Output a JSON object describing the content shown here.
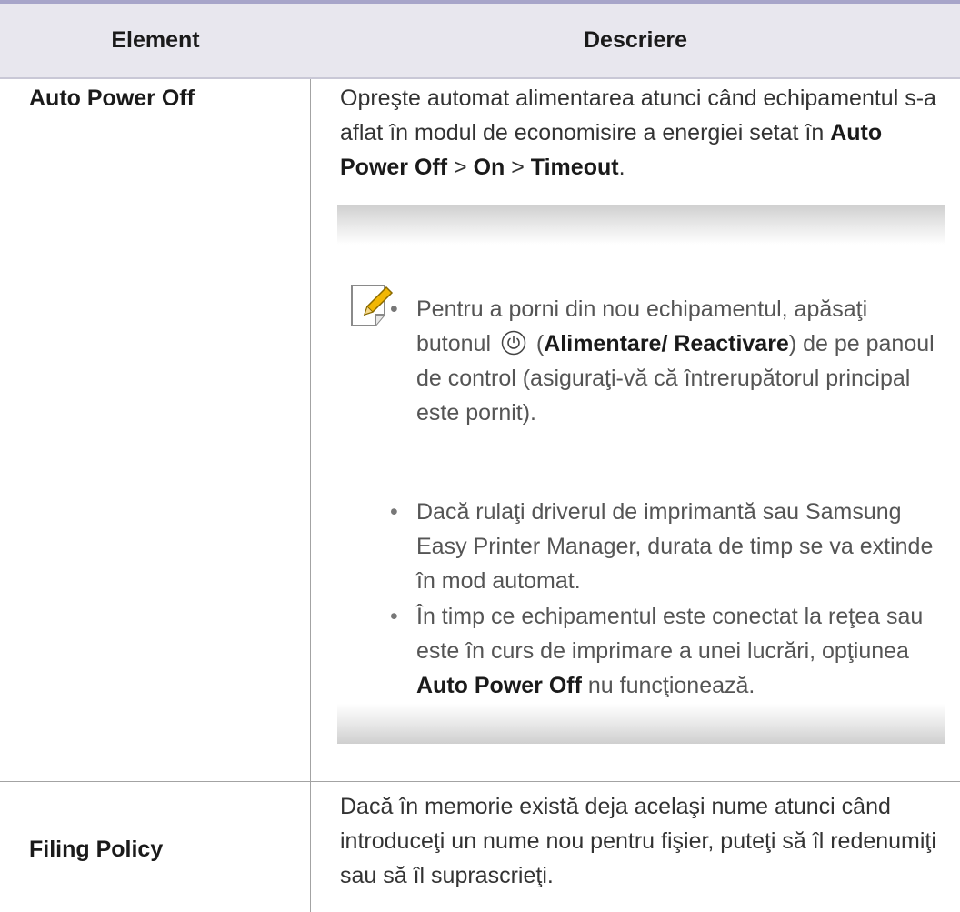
{
  "table": {
    "headers": {
      "element": "Element",
      "description": "Descriere"
    },
    "rows": [
      {
        "label": "Auto Power Off",
        "desc_part1": "Opreşte automat alimentarea atunci când echipamentul s-a aflat în modul de economisire a energiei setat în ",
        "desc_bold1": "Auto Power Off",
        "desc_sep1": " > ",
        "desc_bold2": "On",
        "desc_sep2": " > ",
        "desc_bold3": "Timeout",
        "desc_end": ".",
        "note": {
          "icon": "note-pencil-icon",
          "bullet1_part1": "Pentru a porni din nou echipamentul, apăsaţi butonul ",
          "bullet1_icon": "power-button-icon",
          "bullet1_open_paren": " (",
          "bullet1_bold": "Alimentare/ Reactivare",
          "bullet1_part2": ") de pe panoul de control (asiguraţi-vă că întrerupătorul principal este pornit).",
          "bullet2": "Dacă rulaţi driverul de imprimantă sau Samsung Easy Printer Manager, durata de timp se va extinde în mod automat.",
          "bullet3_part1": "În timp ce echipamentul este conectat la reţea sau este în curs de imprimare a unei lucrări, opţiunea ",
          "bullet3_bold": "Auto Power Off",
          "bullet3_part2": " nu funcţionează."
        }
      },
      {
        "label": "Filing Policy",
        "desc": "Dacă în memorie există deja acelaşi nume atunci când introduceţi un nume nou pentru fişier, puteţi să îl redenumiţi sau să îl suprascrieţi."
      }
    ]
  },
  "colors": {
    "header_rule": "#a7a5c9",
    "header_bg": "#e8e7ee",
    "icon_accent": "#f2b705"
  }
}
